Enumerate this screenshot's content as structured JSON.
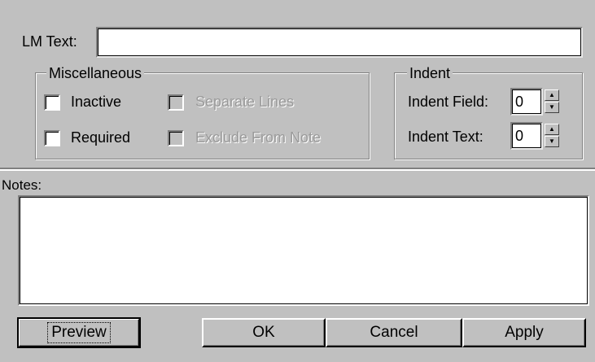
{
  "lm_text": {
    "label": "LM Text:",
    "value": ""
  },
  "misc": {
    "title": "Miscellaneous",
    "inactive": "Inactive",
    "required": "Required",
    "separate_lines": "Separate Lines",
    "exclude_from_note": "Exclude From Note"
  },
  "indent": {
    "title": "Indent",
    "field_label": "Indent Field:",
    "field_value": "0",
    "text_label": "Indent Text:",
    "text_value": "0",
    "up_glyph": "▲",
    "down_glyph": "▼"
  },
  "notes": {
    "label": "Notes:",
    "value": ""
  },
  "buttons": {
    "preview": "Preview",
    "ok": "OK",
    "cancel": "Cancel",
    "apply": "Apply"
  }
}
